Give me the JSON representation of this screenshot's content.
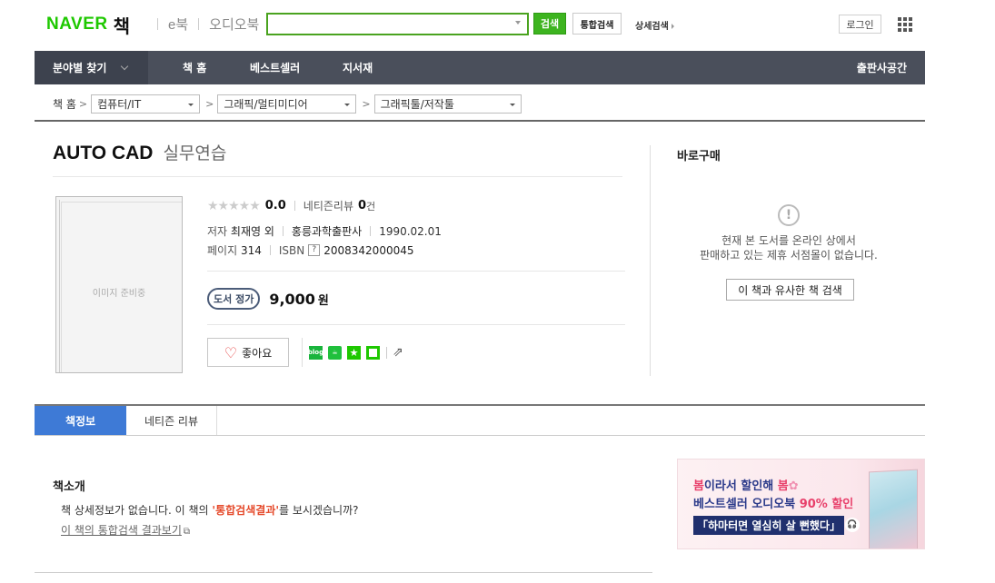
{
  "header": {
    "logo_naver": "NAVER",
    "logo_book": "책",
    "nav_ebook": "e북",
    "nav_audiobook": "오디오북",
    "search_placeholder": "",
    "search_button": "검색",
    "total_search_button": "통합검색",
    "advanced_search": "상세검색",
    "login": "로그인"
  },
  "navbar": {
    "category": "분야별 찾기",
    "items": [
      "책 홈",
      "베스트셀러",
      "지서재"
    ],
    "publisher": "출판사공간"
  },
  "breadcrumb": {
    "home": "책 홈",
    "levels": [
      "컴퓨터/IT",
      "그래픽/멀티미디어",
      "그래픽툴/저작툴"
    ]
  },
  "book": {
    "title": "AUTO CAD",
    "subtitle": "실무연습",
    "cover_placeholder": "이미지 준비중",
    "stars": "★★★★★",
    "score": "0.0",
    "review_label": "네티즌리뷰",
    "review_count": "0",
    "review_unit": "건",
    "author_label": "저자",
    "author": "최재영 외",
    "publisher": "홍릉과학출판사",
    "date": "1990.02.01",
    "pages_label": "페이지",
    "pages": "314",
    "isbn_label": "ISBN",
    "isbn_help": "?",
    "isbn": "2008342000045",
    "price_label": "도서 정가",
    "price": "9,000",
    "price_unit": "원",
    "like_label": "좋아요",
    "share_blog": "blog"
  },
  "buy": {
    "title": "바로구매",
    "message_line1": "현재 본 도서를 온라인 상에서",
    "message_line2": "판매하고 있는 제휴 서점몰이 없습니다.",
    "similar_button": "이 책과 유사한 책 검색"
  },
  "tabs": [
    "책정보",
    "네티즌 리뷰"
  ],
  "intro": {
    "title": "책소개",
    "text_before": "책 상세정보가 없습니다. 이 책의 ",
    "text_highlight": "'통합검색결과'",
    "text_after": "를 보시겠습니까?",
    "link": "이 책의 통합검색 결과보기"
  },
  "ad": {
    "line1_a": "봄",
    "line1_b": "이라서 할인해 ",
    "line1_c": "봄",
    "line2_a": "베스트셀러 오디오북 ",
    "line2_b": "90% 할인",
    "line3": "「하마터면 열심히 살 뻔했다」"
  },
  "colors": {
    "naver_green": "#1ec800",
    "nav_bg": "#4a4f5b",
    "tab_active": "#3e7ad6",
    "highlight_red": "#e54a2b"
  }
}
